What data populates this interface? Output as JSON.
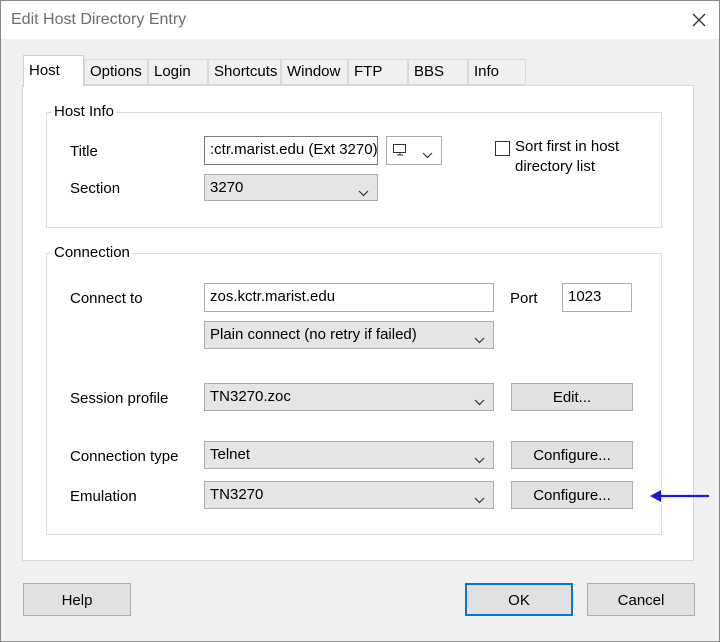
{
  "window": {
    "title": "Edit Host Directory Entry"
  },
  "tabs": [
    {
      "label": "Host"
    },
    {
      "label": "Options"
    },
    {
      "label": "Login"
    },
    {
      "label": "Shortcuts"
    },
    {
      "label": "Window"
    },
    {
      "label": "FTP"
    },
    {
      "label": "BBS"
    },
    {
      "label": "Info"
    }
  ],
  "host_info": {
    "group_label": "Host Info",
    "title_label": "Title",
    "title_value": ":ctr.marist.edu (Ext 3270)",
    "section_label": "Section",
    "section_value": "3270",
    "sort_first_label_line1": "Sort first in host",
    "sort_first_label_line2": "directory list",
    "sort_first_checked": false
  },
  "connection": {
    "group_label": "Connection",
    "connect_to_label": "Connect to",
    "connect_to_value": "zos.kctr.marist.edu",
    "port_label": "Port",
    "port_value": "1023",
    "retry_value": "Plain connect (no retry if failed)",
    "session_profile_label": "Session profile",
    "session_profile_value": "TN3270.zoc",
    "edit_button": "Edit...",
    "connection_type_label": "Connection type",
    "connection_type_value": "Telnet",
    "configure_button": "Configure...",
    "emulation_label": "Emulation",
    "emulation_value": "TN3270",
    "configure_button_2": "Configure..."
  },
  "footer": {
    "help": "Help",
    "ok": "OK",
    "cancel": "Cancel"
  },
  "colors": {
    "accent": "#0078d7",
    "arrow": "#1a1adb"
  }
}
